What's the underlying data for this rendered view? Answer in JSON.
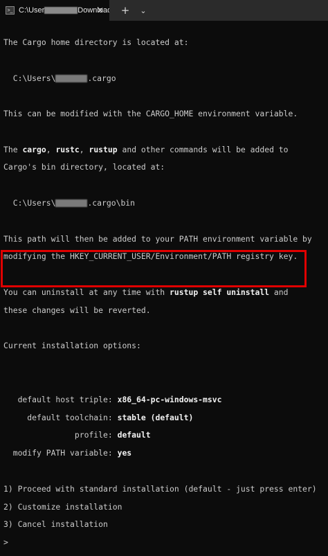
{
  "window": {
    "tab_title_prefix": "C:\\User",
    "tab_title_suffix": "Downloads\\",
    "tab_close": "✕",
    "new_tab": "+",
    "dropdown": "⌄"
  },
  "terminal": {
    "l1": "The Cargo home directory is located at:",
    "l2a": "  C:\\Users\\",
    "l2b": ".cargo",
    "l3": "This can be modified with the CARGO_HOME environment variable.",
    "l4a": "The ",
    "l4cargo": "cargo",
    "l4c1": ", ",
    "l4rustc": "rustc",
    "l4c2": ", ",
    "l4rustup": "rustup",
    "l4b": " and other commands will be added to",
    "l5": "Cargo's bin directory, located at:",
    "l6a": "  C:\\Users\\",
    "l6b": ".cargo\\bin",
    "l7": "This path will then be added to your PATH environment variable by",
    "l8": "modifying the HKEY_CURRENT_USER/Environment/PATH registry key.",
    "l9a": "You can uninstall at any time with ",
    "l9b": "rustup self uninstall",
    "l9c": " and",
    "l10": "these changes will be reverted.",
    "l11": "Current installation options:",
    "opt1_label": "   default host triple: ",
    "opt1_value": "x86_64-pc-windows-msvc",
    "opt2_label": "     default toolchain: ",
    "opt2_value": "stable (default)",
    "opt3_label": "               profile: ",
    "opt3_value": "default",
    "opt4_label": "  modify PATH variable: ",
    "opt4_value": "yes",
    "menu1": "1) Proceed with standard installation (default - just press enter)",
    "menu2": "2) Customize installation",
    "menu3": "3) Cancel installation",
    "prompt": ">"
  },
  "colors": {
    "background": "#0c0c0c",
    "foreground": "#cccccc",
    "highlight_border": "#e00000"
  }
}
